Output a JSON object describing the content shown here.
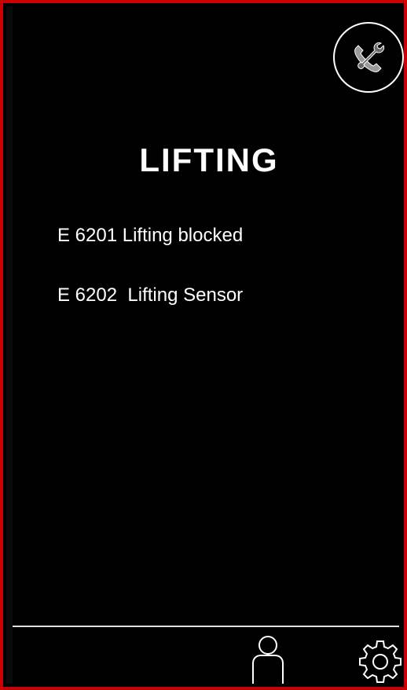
{
  "screen": {
    "title": "LIFTING",
    "border_color": "#cc0000",
    "background_color": "#000000",
    "text_color": "#ffffff"
  },
  "errors": [
    {
      "label": "E 6201 Lifting blocked"
    },
    {
      "label": "E 6202  Lifting Sensor"
    }
  ],
  "icons": {
    "service": "phone-wrench-icon",
    "user": "user-icon",
    "settings": "gear-icon"
  }
}
